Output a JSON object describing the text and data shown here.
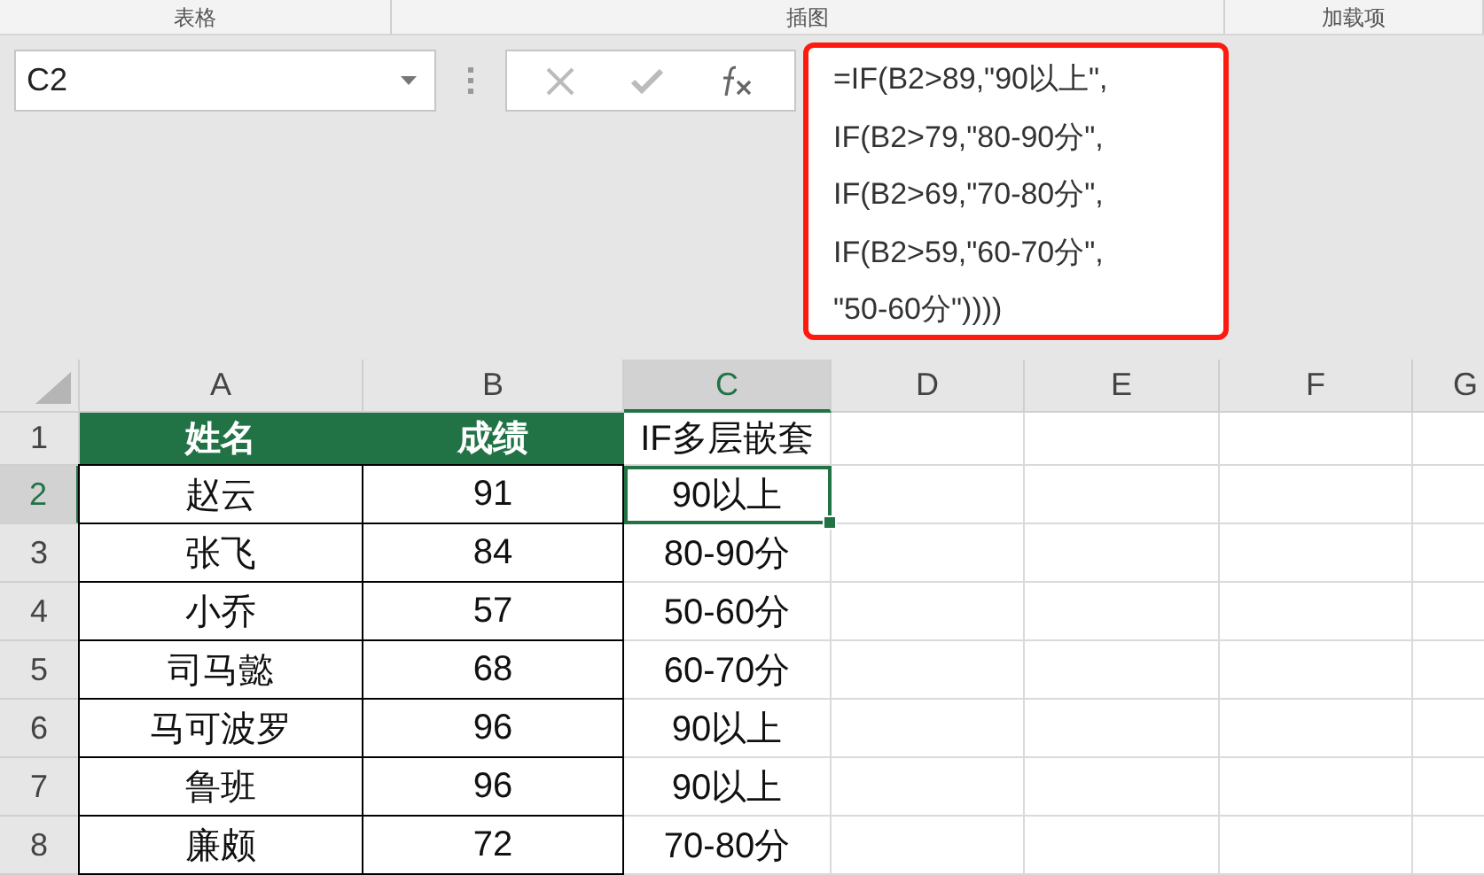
{
  "ribbon_groups": [
    "表格",
    "插图",
    "加载项"
  ],
  "name_box": {
    "value": "C2"
  },
  "formula_bar": {
    "lines": [
      "=IF(B2>89,\"90以上\",",
      "IF(B2>79,\"80-90分\",",
      "IF(B2>69,\"70-80分\",",
      "IF(B2>59,\"60-70分\",",
      "\"50-60分\"))))"
    ],
    "highlighted": true
  },
  "columns": [
    {
      "label": "A",
      "selected": false
    },
    {
      "label": "B",
      "selected": false
    },
    {
      "label": "C",
      "selected": true
    },
    {
      "label": "D",
      "selected": false
    },
    {
      "label": "E",
      "selected": false
    },
    {
      "label": "F",
      "selected": false
    },
    {
      "label": "G",
      "selected": false
    }
  ],
  "rows": [
    {
      "number": "1",
      "selected": false,
      "kind": "header",
      "cells": [
        {
          "text": "姓名",
          "selected": false
        },
        {
          "text": "成绩",
          "selected": false
        },
        {
          "text": "IF多层嵌套",
          "selected": false
        }
      ]
    },
    {
      "number": "2",
      "selected": true,
      "kind": "data",
      "cells": [
        {
          "text": "赵云",
          "selected": false
        },
        {
          "text": "91",
          "selected": false
        },
        {
          "text": "90以上",
          "selected": true
        }
      ]
    },
    {
      "number": "3",
      "selected": false,
      "kind": "data",
      "cells": [
        {
          "text": "张飞",
          "selected": false
        },
        {
          "text": "84",
          "selected": false
        },
        {
          "text": "80-90分",
          "selected": false
        }
      ]
    },
    {
      "number": "4",
      "selected": false,
      "kind": "data",
      "cells": [
        {
          "text": "小乔",
          "selected": false
        },
        {
          "text": "57",
          "selected": false
        },
        {
          "text": "50-60分",
          "selected": false
        }
      ]
    },
    {
      "number": "5",
      "selected": false,
      "kind": "data",
      "cells": [
        {
          "text": "司马懿",
          "selected": false
        },
        {
          "text": "68",
          "selected": false
        },
        {
          "text": "60-70分",
          "selected": false
        }
      ]
    },
    {
      "number": "6",
      "selected": false,
      "kind": "data",
      "cells": [
        {
          "text": "马可波罗",
          "selected": false
        },
        {
          "text": "96",
          "selected": false
        },
        {
          "text": "90以上",
          "selected": false
        }
      ]
    },
    {
      "number": "7",
      "selected": false,
      "kind": "data",
      "cells": [
        {
          "text": "鲁班",
          "selected": false
        },
        {
          "text": "96",
          "selected": false
        },
        {
          "text": "90以上",
          "selected": false
        }
      ]
    },
    {
      "number": "8",
      "selected": false,
      "kind": "data",
      "cells": [
        {
          "text": "廉颇",
          "selected": false
        },
        {
          "text": "72",
          "selected": false
        },
        {
          "text": "70-80分",
          "selected": false
        }
      ]
    }
  ]
}
